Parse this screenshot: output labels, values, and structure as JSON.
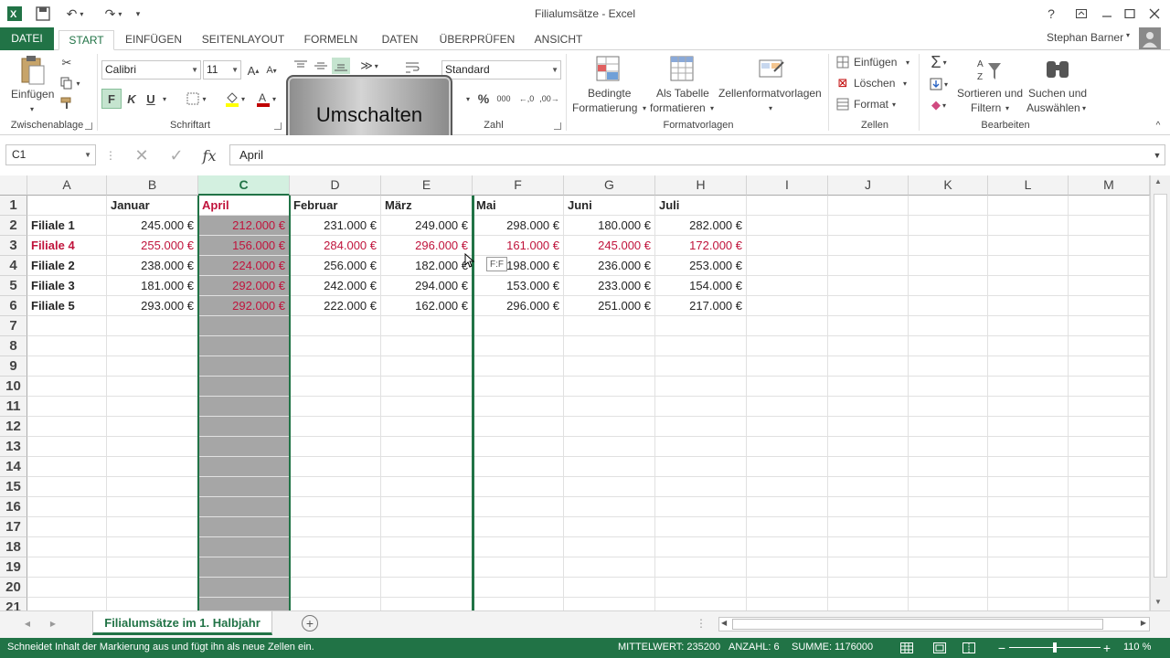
{
  "window": {
    "title": "Filialumsätze - Excel",
    "help": "?",
    "icons": [
      "excel-icon",
      "save-icon",
      "undo-icon",
      "redo-icon",
      "customize-icon"
    ]
  },
  "tabs": [
    "DATEI",
    "START",
    "EINFÜGEN",
    "SEITENLAYOUT",
    "FORMELN",
    "DATEN",
    "ÜBERPRÜFEN",
    "ANSICHT"
  ],
  "user": "Stephan Barner",
  "ribbon": {
    "clipboard": {
      "paste": "Einfügen",
      "group": "Zwischenablage"
    },
    "font": {
      "name": "Calibri",
      "size": "11",
      "bold": "F",
      "italic": "K",
      "underline": "U",
      "group": "Schriftart"
    },
    "number": {
      "format": "Standard",
      "percent": "%",
      "thousands": "000",
      "group": "Zahl"
    },
    "styles": {
      "conditional_1": "Bedingte",
      "conditional_2": "Formatierung",
      "table_1": "Als Tabelle",
      "table_2": "formatieren",
      "cellstyles": "Zellenformatvorlagen",
      "group": "Formatvorlagen"
    },
    "cells": {
      "insert": "Einfügen",
      "delete": "Löschen",
      "format": "Format",
      "group": "Zellen"
    },
    "editing": {
      "sort_1": "Sortieren und",
      "sort_2": "Filtern",
      "find_1": "Suchen und",
      "find_2": "Auswählen",
      "group": "Bearbeiten"
    }
  },
  "overlay": {
    "key": "Umschalten"
  },
  "formula": {
    "namebox": "C1",
    "fx": "fx",
    "content": "April"
  },
  "columns": [
    "A",
    "B",
    "C",
    "D",
    "E",
    "F",
    "G",
    "H",
    "I",
    "J",
    "K",
    "L",
    "M"
  ],
  "rows": [
    [
      "",
      "Januar",
      "April",
      "Februar",
      "März",
      "Mai",
      "Juni",
      "Juli"
    ],
    [
      "Filiale 1",
      "245.000 €",
      "212.000 €",
      "231.000 €",
      "249.000 €",
      "298.000 €",
      "180.000 €",
      "282.000 €"
    ],
    [
      "Filiale 4",
      "255.000 €",
      "156.000 €",
      "284.000 €",
      "296.000 €",
      "161.000 €",
      "245.000 €",
      "172.000 €"
    ],
    [
      "Filiale 2",
      "238.000 €",
      "224.000 €",
      "256.000 €",
      "182.000 €",
      "198.000 €",
      "236.000 €",
      "253.000 €"
    ],
    [
      "Filiale 3",
      "181.000 €",
      "292.000 €",
      "242.000 €",
      "294.000 €",
      "153.000 €",
      "233.000 €",
      "154.000 €"
    ],
    [
      "Filiale 5",
      "293.000 €",
      "292.000 €",
      "222.000 €",
      "162.000 €",
      "296.000 €",
      "251.000 €",
      "217.000 €"
    ]
  ],
  "row_numbers": [
    "1",
    "2",
    "3",
    "4",
    "5",
    "6",
    "7",
    "8",
    "9",
    "10",
    "11",
    "12",
    "13",
    "14",
    "15",
    "16",
    "17",
    "18",
    "19",
    "20",
    "21"
  ],
  "drag_tooltip": "F:F",
  "sheet": {
    "name": "Filialumsätze im 1. Halbjahr"
  },
  "status": {
    "message": "Schneidet Inhalt der Markierung aus und fügt ihn als neue Zellen ein.",
    "average": "MITTELWERT: 235200",
    "count": "ANZAHL: 6",
    "sum": "SUMME: 1176000",
    "zoom": "110 %"
  },
  "colors": {
    "accent": "#217346",
    "highlight_red": "#c0143c",
    "moving_column": "#a6a6a6"
  }
}
